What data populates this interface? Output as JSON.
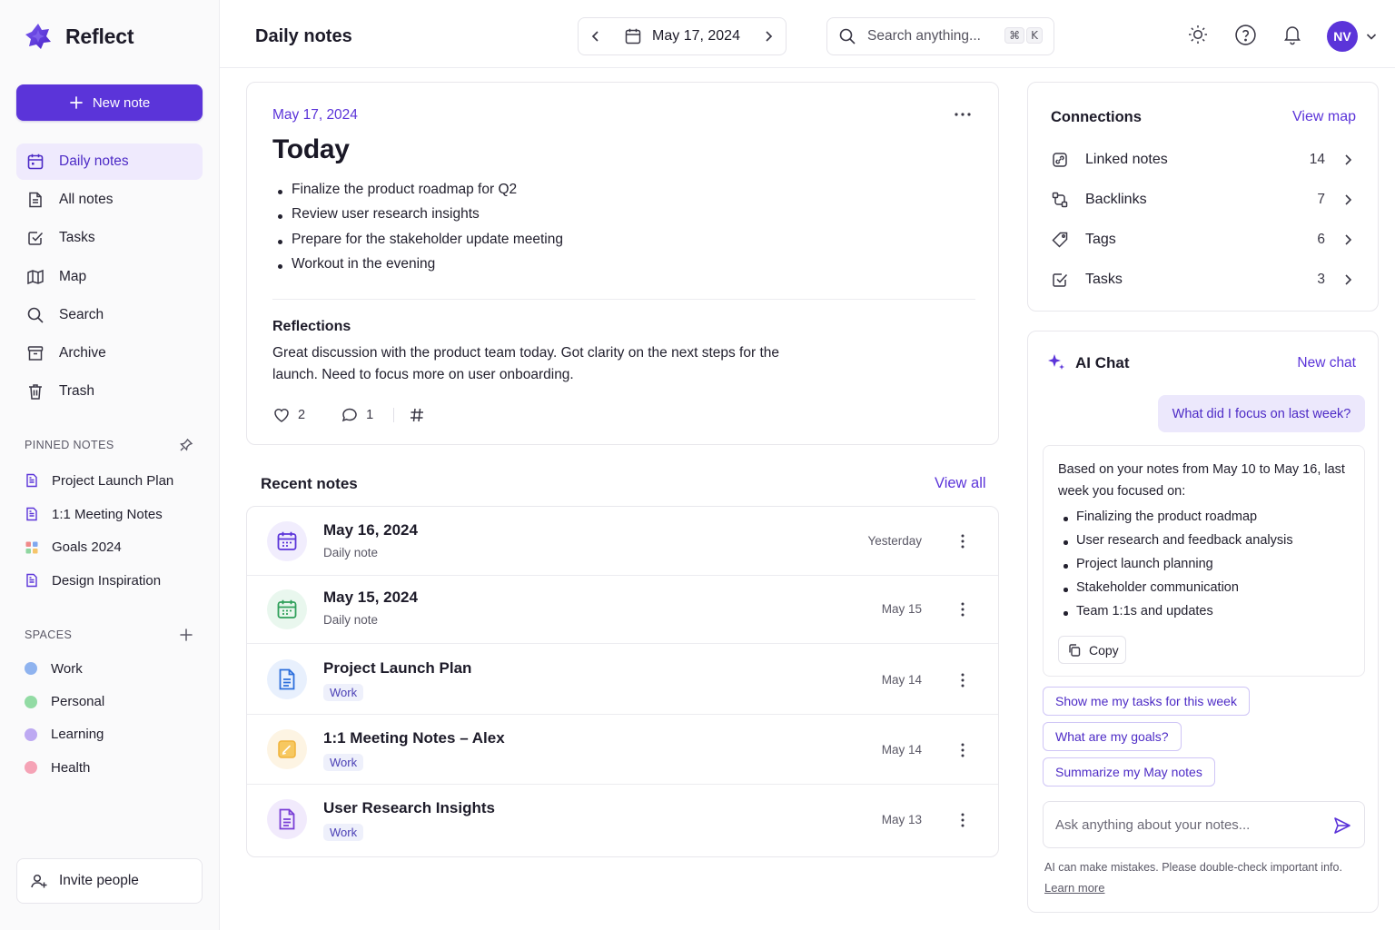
{
  "app": {
    "name": "Reflect"
  },
  "sidebar": {
    "new_note_label": "New note",
    "nav": [
      {
        "label": "Daily notes",
        "icon": "calendar-icon",
        "active": true
      },
      {
        "label": "All notes",
        "icon": "notes-icon",
        "active": false
      },
      {
        "label": "Tasks",
        "icon": "check-square-icon",
        "active": false
      },
      {
        "label": "Map",
        "icon": "map-icon",
        "active": false
      },
      {
        "label": "Search",
        "icon": "search-icon",
        "active": false
      },
      {
        "label": "Archive",
        "icon": "archive-icon",
        "active": false
      },
      {
        "label": "Trash",
        "icon": "trash-icon",
        "active": false
      }
    ],
    "pinned_label": "PINNED NOTES",
    "pinned": [
      {
        "label": "Project Launch Plan",
        "icon": "document-icon"
      },
      {
        "label": "1:1 Meeting Notes",
        "icon": "document-icon"
      },
      {
        "label": "Goals 2024",
        "icon": "goals-icon"
      },
      {
        "label": "Design Inspiration",
        "icon": "document-icon"
      }
    ],
    "spaces_label": "SPACES",
    "spaces": [
      {
        "label": "Work",
        "color": "#8fb3ef"
      },
      {
        "label": "Personal",
        "color": "#92dba4"
      },
      {
        "label": "Learning",
        "color": "#bda9f2"
      },
      {
        "label": "Health",
        "color": "#f5a3b6"
      }
    ],
    "invite_label": "Invite people"
  },
  "header": {
    "title": "Daily notes",
    "date": "May 17, 2024",
    "search_placeholder": "Search anything...",
    "shortcut_cmd": "⌘",
    "shortcut_key": "K",
    "avatar_initials": "NV"
  },
  "today": {
    "date": "May 17, 2024",
    "title": "Today",
    "bullets": [
      "Finalize the product roadmap for Q2",
      "Review user research insights",
      "Prepare for the stakeholder update meeting",
      "Workout in the evening"
    ],
    "reflections_title": "Reflections",
    "reflections_body": "Great discussion with the product team today. Got clarity on the next steps for the launch. Need to focus more on user onboarding.",
    "likes": "2",
    "comments": "1"
  },
  "recent": {
    "title": "Recent notes",
    "view_all": "View all",
    "items": [
      {
        "title": "May 16, 2024",
        "subtitle": "Daily note",
        "tag": "",
        "date": "Yesterday",
        "icon": "calendar-icon",
        "color": "#5b34d9"
      },
      {
        "title": "May 15, 2024",
        "subtitle": "Daily note",
        "tag": "",
        "date": "May 15",
        "icon": "calendar-icon",
        "color": "#2fa05a"
      },
      {
        "title": "Project Launch Plan",
        "subtitle": "",
        "tag": "Work",
        "date": "May 14",
        "icon": "document-icon",
        "color": "#2d6fdc"
      },
      {
        "title": "1:1 Meeting Notes – Alex",
        "subtitle": "",
        "tag": "Work",
        "date": "May 14",
        "icon": "note-icon",
        "color": "#f0b23a"
      },
      {
        "title": "User Research Insights",
        "subtitle": "",
        "tag": "Work",
        "date": "May 13",
        "icon": "document-icon",
        "color": "#7a3fd6"
      }
    ]
  },
  "connections": {
    "title": "Connections",
    "view_map": "View map",
    "items": [
      {
        "label": "Linked notes",
        "count": "14",
        "icon": "linked-notes-icon"
      },
      {
        "label": "Backlinks",
        "count": "7",
        "icon": "backlinks-icon"
      },
      {
        "label": "Tags",
        "count": "6",
        "icon": "tag-icon"
      },
      {
        "label": "Tasks",
        "count": "3",
        "icon": "check-square-icon"
      }
    ]
  },
  "ai_chat": {
    "title": "AI Chat",
    "new_chat": "New chat",
    "user_message": "What did I focus on last week?",
    "answer_intro": "Based on your notes from May 10 to May 16, last week you focused on:",
    "answer_points": [
      "Finalizing the product roadmap",
      "User research and feedback analysis",
      "Project launch planning",
      "Stakeholder communication",
      "Team 1:1s and updates"
    ],
    "copy_label": "Copy",
    "suggestions": [
      "Show me my tasks for this week",
      "What are my goals?",
      "Summarize my May notes"
    ],
    "input_placeholder": "Ask anything about your notes...",
    "disclaimer": "AI can make mistakes. Please double-check important info.",
    "learn_more": "Learn more"
  },
  "colors": {
    "accent": "#5b34d9",
    "accent_soft": "#efeafd"
  }
}
